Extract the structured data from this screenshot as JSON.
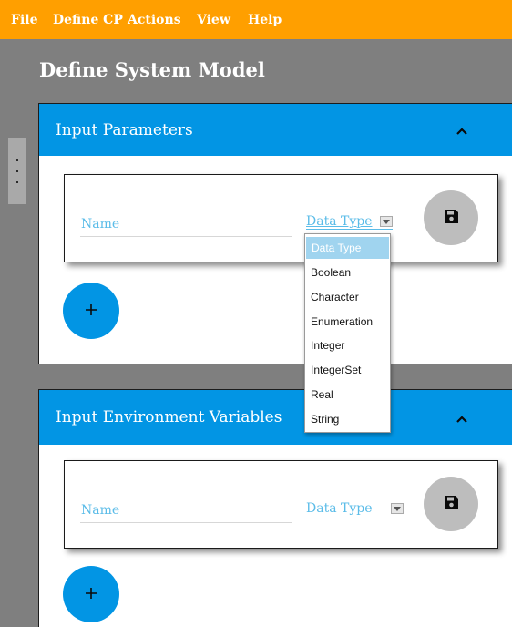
{
  "menubar": {
    "items": [
      {
        "label": "File"
      },
      {
        "label": "Define CP"
      },
      {
        "label": "Actions"
      },
      {
        "label": "View"
      },
      {
        "label": "Help"
      }
    ]
  },
  "page": {
    "title": "Define System Model"
  },
  "input_parameters": {
    "title": "Input Parameters",
    "collapse_icon": "chevron-up-icon",
    "name_placeholder": "Name",
    "data_type_value": "Data Type",
    "save_icon": "floppy-disk-icon",
    "add_icon": "plus-icon"
  },
  "input_environment_variables": {
    "title": "Input Environment Variables",
    "collapse_icon": "chevron-up-icon",
    "name_placeholder": "Name",
    "data_type_value": "Data Type",
    "save_icon": "floppy-disk-icon",
    "add_icon": "plus-icon"
  },
  "data_type_dropdown": {
    "options": [
      {
        "label": "Data Type"
      },
      {
        "label": "Boolean"
      },
      {
        "label": "Character"
      },
      {
        "label": "Enumeration"
      },
      {
        "label": "Integer"
      },
      {
        "label": "IntegerSet"
      },
      {
        "label": "Real"
      },
      {
        "label": "String"
      }
    ],
    "selected": "Data Type"
  },
  "colors": {
    "menubar_bg": "#ff9f00",
    "accent_blue": "#0295e4",
    "page_bg": "#7f7f7f",
    "field_text": "#5bbce8",
    "save_button_bg": "#bdbdbd",
    "dropdown_selected_bg": "#a0d4ef"
  }
}
